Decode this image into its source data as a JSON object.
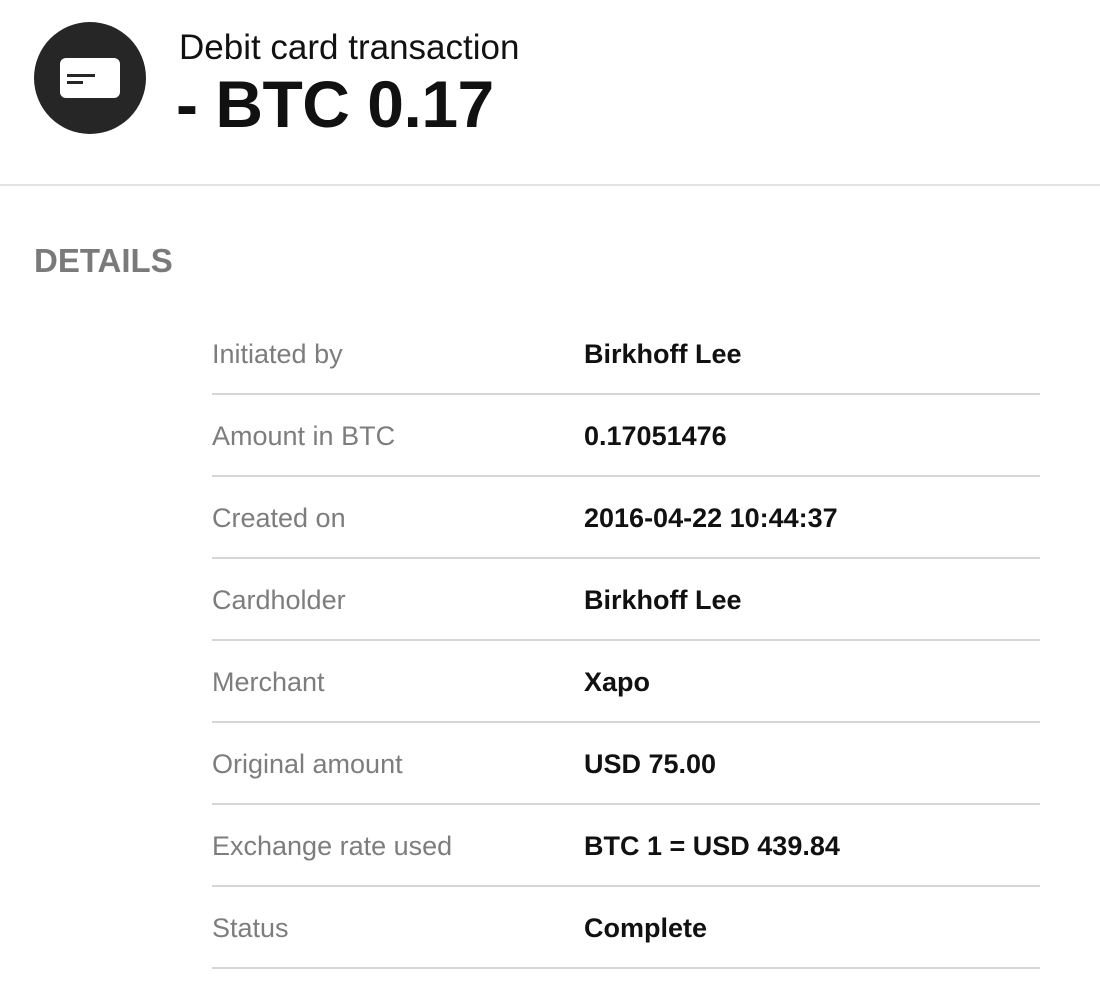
{
  "header": {
    "icon": "credit-card-icon",
    "transaction_type": "Debit card transaction",
    "amount": "- BTC 0.17"
  },
  "details": {
    "title": "DETAILS",
    "rows": [
      {
        "label": "Initiated by",
        "value": "Birkhoff Lee"
      },
      {
        "label": "Amount in BTC",
        "value": "0.17051476"
      },
      {
        "label": "Created on",
        "value": "2016-04-22 10:44:37"
      },
      {
        "label": "Cardholder",
        "value": "Birkhoff Lee"
      },
      {
        "label": "Merchant",
        "value": "Xapo"
      },
      {
        "label": "Original amount",
        "value": "USD 75.00"
      },
      {
        "label": "Exchange rate used",
        "value": "BTC 1 = USD 439.84"
      },
      {
        "label": "Status",
        "value": "Complete"
      }
    ]
  },
  "colors": {
    "avatar_background": "#262626",
    "label_text": "#7d7d7d",
    "value_text": "#111111",
    "divider": "#d6d6d6"
  }
}
